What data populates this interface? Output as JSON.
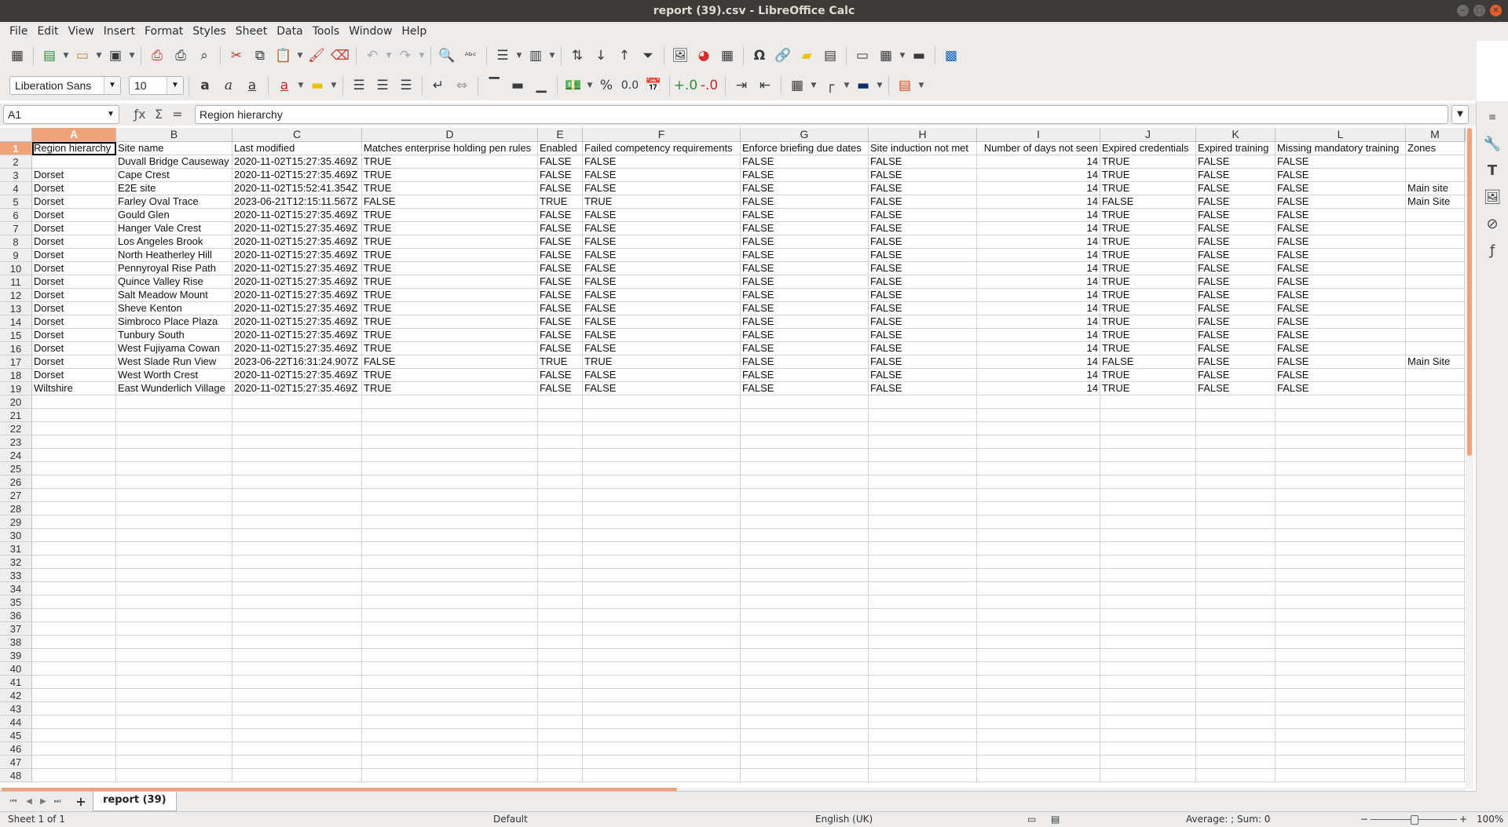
{
  "window": {
    "title": "report (39).csv - LibreOffice Calc"
  },
  "menu": [
    "File",
    "Edit",
    "View",
    "Insert",
    "Format",
    "Styles",
    "Sheet",
    "Data",
    "Tools",
    "Window",
    "Help"
  ],
  "format_toolbar": {
    "font_name": "Liberation Sans",
    "font_size": "10"
  },
  "formula_bar": {
    "cell_ref": "A1",
    "content": "Region hierarchy"
  },
  "columns": [
    {
      "letter": "A",
      "width": 107
    },
    {
      "letter": "B",
      "width": 148
    },
    {
      "letter": "C",
      "width": 165
    },
    {
      "letter": "D",
      "width": 224
    },
    {
      "letter": "E",
      "width": 57
    },
    {
      "letter": "F",
      "width": 201
    },
    {
      "letter": "G",
      "width": 163
    },
    {
      "letter": "H",
      "width": 138
    },
    {
      "letter": "I",
      "width": 157
    },
    {
      "letter": "J",
      "width": 122
    },
    {
      "letter": "K",
      "width": 101
    },
    {
      "letter": "L",
      "width": 166
    },
    {
      "letter": "M",
      "width": 75
    }
  ],
  "rows": [
    [
      "Region hierarchy",
      "Site name",
      "Last modified",
      "Matches enterprise holding pen rules",
      "Enabled",
      "Failed competency requirements",
      "Enforce briefing due dates",
      "Site induction not met",
      "Number of days not seen",
      "Expired credentials",
      "Expired training",
      "Missing mandatory training",
      "Zones"
    ],
    [
      "",
      "Duvall Bridge Causeway",
      "2020-11-02T15:27:35.469Z",
      "TRUE",
      "FALSE",
      "FALSE",
      "FALSE",
      "FALSE",
      "14",
      "TRUE",
      "FALSE",
      "FALSE",
      ""
    ],
    [
      "Dorset",
      "Cape Crest",
      "2020-11-02T15:27:35.469Z",
      "TRUE",
      "FALSE",
      "FALSE",
      "FALSE",
      "FALSE",
      "14",
      "TRUE",
      "FALSE",
      "FALSE",
      ""
    ],
    [
      "Dorset",
      "E2E site",
      "2020-11-02T15:52:41.354Z",
      "TRUE",
      "FALSE",
      "FALSE",
      "FALSE",
      "FALSE",
      "14",
      "TRUE",
      "FALSE",
      "FALSE",
      "Main site"
    ],
    [
      "Dorset",
      "Farley Oval Trace",
      "2023-06-21T12:15:11.567Z",
      "FALSE",
      "TRUE",
      "TRUE",
      "FALSE",
      "FALSE",
      "14",
      "FALSE",
      "FALSE",
      "FALSE",
      "Main Site"
    ],
    [
      "Dorset",
      "Gould Glen",
      "2020-11-02T15:27:35.469Z",
      "TRUE",
      "FALSE",
      "FALSE",
      "FALSE",
      "FALSE",
      "14",
      "TRUE",
      "FALSE",
      "FALSE",
      ""
    ],
    [
      "Dorset",
      "Hanger Vale Crest",
      "2020-11-02T15:27:35.469Z",
      "TRUE",
      "FALSE",
      "FALSE",
      "FALSE",
      "FALSE",
      "14",
      "TRUE",
      "FALSE",
      "FALSE",
      ""
    ],
    [
      "Dorset",
      "Los Angeles Brook",
      "2020-11-02T15:27:35.469Z",
      "TRUE",
      "FALSE",
      "FALSE",
      "FALSE",
      "FALSE",
      "14",
      "TRUE",
      "FALSE",
      "FALSE",
      ""
    ],
    [
      "Dorset",
      "North Heatherley Hill",
      "2020-11-02T15:27:35.469Z",
      "TRUE",
      "FALSE",
      "FALSE",
      "FALSE",
      "FALSE",
      "14",
      "TRUE",
      "FALSE",
      "FALSE",
      ""
    ],
    [
      "Dorset",
      "Pennyroyal Rise Path",
      "2020-11-02T15:27:35.469Z",
      "TRUE",
      "FALSE",
      "FALSE",
      "FALSE",
      "FALSE",
      "14",
      "TRUE",
      "FALSE",
      "FALSE",
      ""
    ],
    [
      "Dorset",
      "Quince Valley Rise",
      "2020-11-02T15:27:35.469Z",
      "TRUE",
      "FALSE",
      "FALSE",
      "FALSE",
      "FALSE",
      "14",
      "TRUE",
      "FALSE",
      "FALSE",
      ""
    ],
    [
      "Dorset",
      "Salt Meadow Mount",
      "2020-11-02T15:27:35.469Z",
      "TRUE",
      "FALSE",
      "FALSE",
      "FALSE",
      "FALSE",
      "14",
      "TRUE",
      "FALSE",
      "FALSE",
      ""
    ],
    [
      "Dorset",
      "Sheve Kenton",
      "2020-11-02T15:27:35.469Z",
      "TRUE",
      "FALSE",
      "FALSE",
      "FALSE",
      "FALSE",
      "14",
      "TRUE",
      "FALSE",
      "FALSE",
      ""
    ],
    [
      "Dorset",
      "Simbroco Place Plaza",
      "2020-11-02T15:27:35.469Z",
      "TRUE",
      "FALSE",
      "FALSE",
      "FALSE",
      "FALSE",
      "14",
      "TRUE",
      "FALSE",
      "FALSE",
      ""
    ],
    [
      "Dorset",
      "Tunbury South",
      "2020-11-02T15:27:35.469Z",
      "TRUE",
      "FALSE",
      "FALSE",
      "FALSE",
      "FALSE",
      "14",
      "TRUE",
      "FALSE",
      "FALSE",
      ""
    ],
    [
      "Dorset",
      "West Fujiyama Cowan",
      "2020-11-02T15:27:35.469Z",
      "TRUE",
      "FALSE",
      "FALSE",
      "FALSE",
      "FALSE",
      "14",
      "TRUE",
      "FALSE",
      "FALSE",
      ""
    ],
    [
      "Dorset",
      "West Slade Run View",
      "2023-06-22T16:31:24.907Z",
      "FALSE",
      "TRUE",
      "TRUE",
      "FALSE",
      "FALSE",
      "14",
      "FALSE",
      "FALSE",
      "FALSE",
      "Main Site"
    ],
    [
      "Dorset",
      "West Worth Crest",
      "2020-11-02T15:27:35.469Z",
      "TRUE",
      "FALSE",
      "FALSE",
      "FALSE",
      "FALSE",
      "14",
      "TRUE",
      "FALSE",
      "FALSE",
      ""
    ],
    [
      "Wiltshire",
      "East Wunderlich Village",
      "2020-11-02T15:27:35.469Z",
      "TRUE",
      "FALSE",
      "FALSE",
      "FALSE",
      "FALSE",
      "14",
      "TRUE",
      "FALSE",
      "FALSE",
      ""
    ]
  ],
  "numeric_columns": [
    8
  ],
  "visible_row_count": 48,
  "sheet_tab": "report (39)",
  "status": {
    "sheet": "Sheet 1 of 1",
    "style": "Default",
    "language": "English (UK)",
    "selection": "Average: ; Sum: 0",
    "zoom": "100%",
    "zoom_level": 100
  }
}
